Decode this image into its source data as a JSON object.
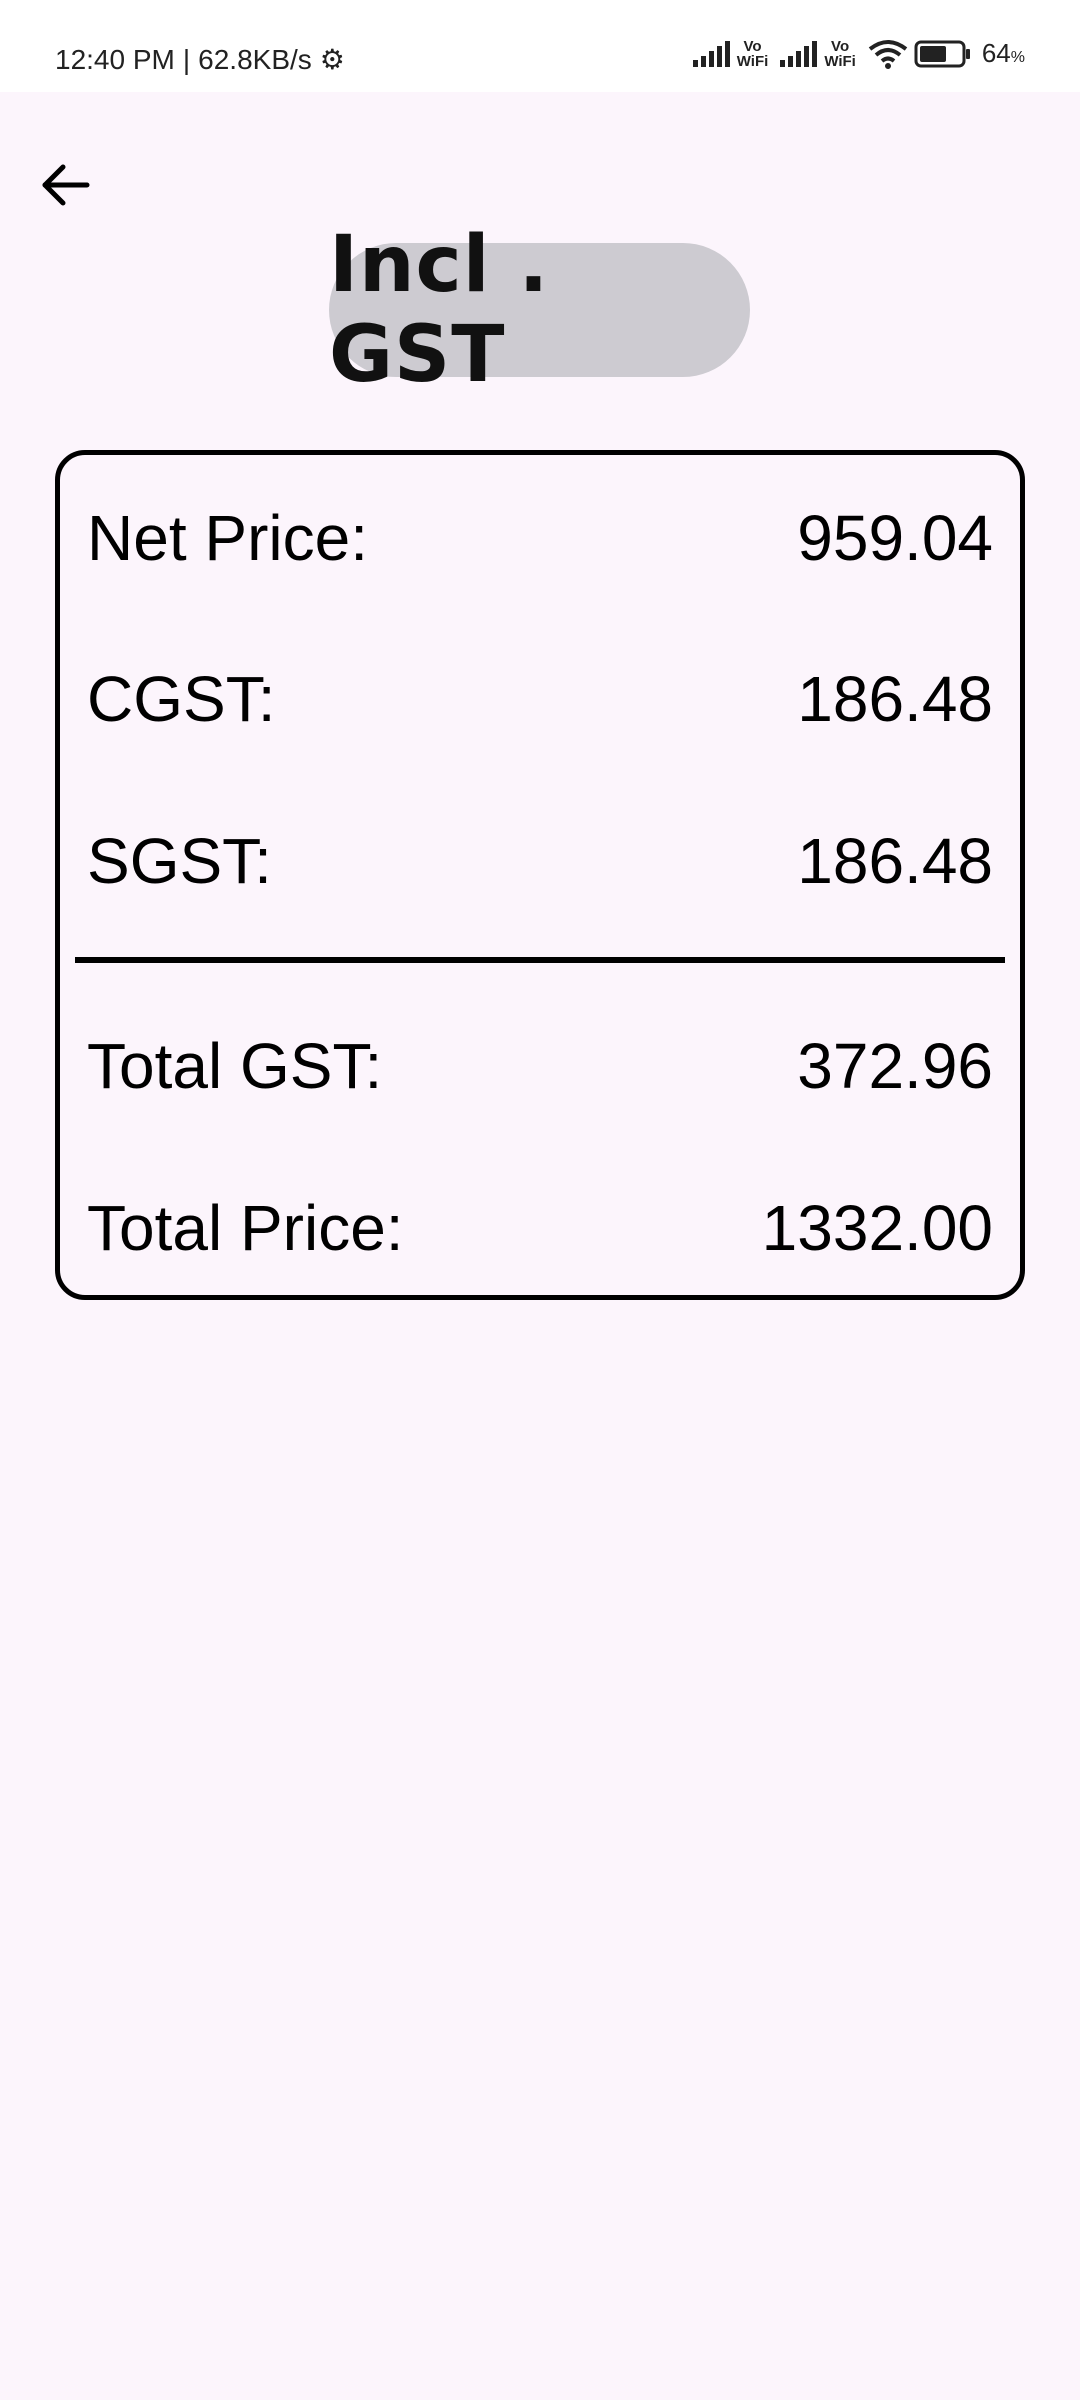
{
  "status_bar": {
    "time": "12:40 PM",
    "separator": "|",
    "speed": "62.8KB/s",
    "vowifi_1_top": "Vo",
    "vowifi_1_bottom": "WiFi",
    "vowifi_2_top": "Vo",
    "vowifi_2_bottom": "WiFi",
    "battery_percent": "64",
    "battery_unit": "%",
    "battery_level": 0.64
  },
  "header": {
    "title": "Incl . GST",
    "back_icon": "arrow-left-icon"
  },
  "summary": {
    "net_price_label": "Net Price:",
    "net_price_value": "959.04",
    "cgst_label": "CGST:",
    "cgst_value": "186.48",
    "sgst_label": "SGST:",
    "sgst_value": "186.48",
    "total_gst_label": "Total GST:",
    "total_gst_value": "372.96",
    "total_price_label": "Total Price:",
    "total_price_value": "1332.00"
  },
  "colors": {
    "background": "#fcf5fc",
    "pill": "#cdcbd1",
    "border": "#000000"
  }
}
